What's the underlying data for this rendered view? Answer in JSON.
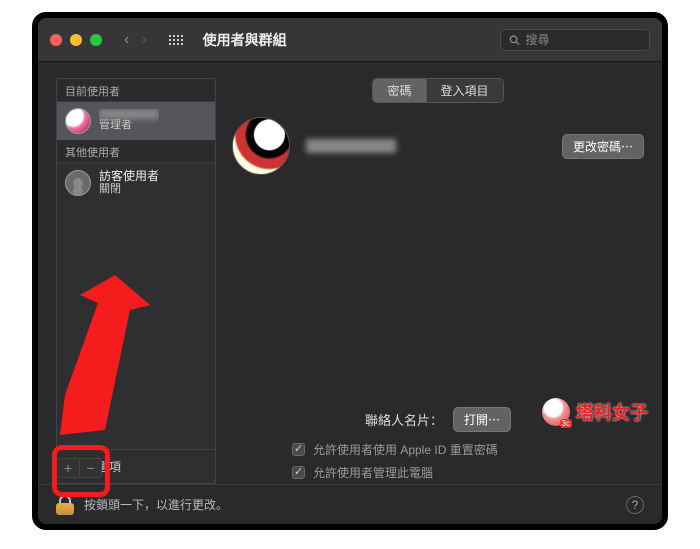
{
  "window": {
    "title": "使用者與群組",
    "search_placeholder": "搜尋"
  },
  "sidebar": {
    "current_heading": "目前使用者",
    "other_heading": "其他使用者",
    "current": {
      "role": "管理者"
    },
    "guest": {
      "name": "訪客使用者",
      "status": "關閉"
    },
    "login_options": "入選項"
  },
  "tabs": {
    "password": "密碼",
    "login_items": "登入項目"
  },
  "main": {
    "change_password": "更改密碼⋯",
    "contact_card_label": "聯絡人名片：",
    "open": "打開⋯",
    "allow_appleid_reset": "允許使用者使用 Apple ID 重置密碼",
    "allow_admin": "允許使用者管理此電腦"
  },
  "footer": {
    "lock_hint": "按鎖頭一下，以進行更改。"
  },
  "watermark": "塔科女子"
}
